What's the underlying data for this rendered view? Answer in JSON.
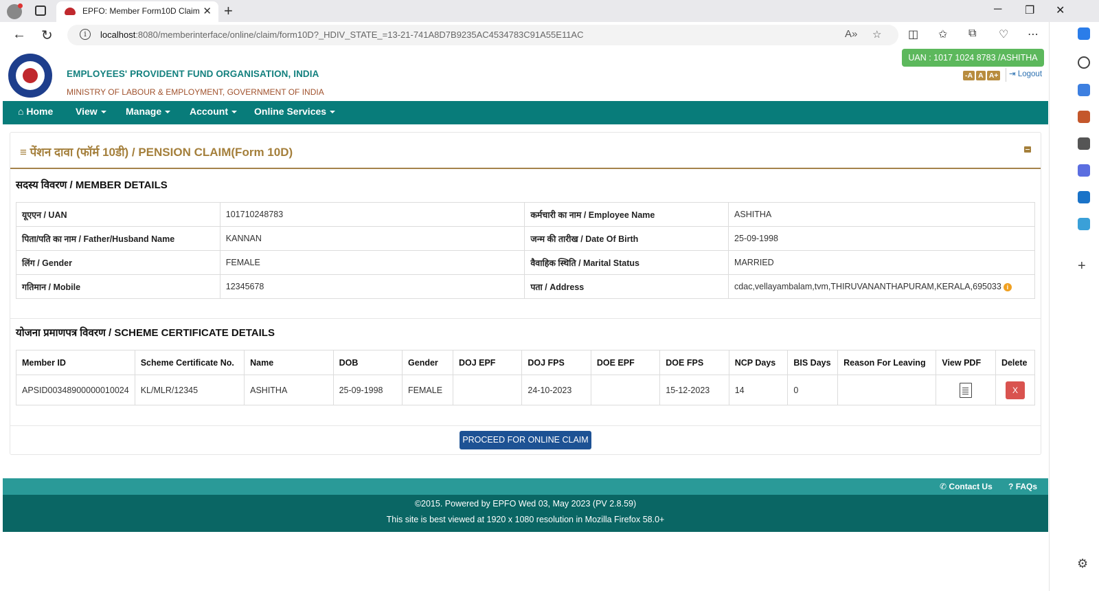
{
  "browser": {
    "tab_title": "EPFO: Member Form10D Claim",
    "url_host": "localhost",
    "url_rest": ":8080/memberinterface/online/claim/form10D?_HDIV_STATE_=13-21-741A8D7B9235AC4534783C91A55E11AC"
  },
  "header": {
    "org_name": "EMPLOYEES' PROVIDENT FUND ORGANISATION, INDIA",
    "ministry": "MINISTRY OF LABOUR & EMPLOYMENT, GOVERNMENT OF INDIA",
    "uan_badge": "UAN : 1017 1024 8783 /ASHITHA",
    "font_small": "-A",
    "font_normal": "A",
    "font_large": "A+",
    "logout": "Logout"
  },
  "nav": {
    "home": "Home",
    "view": "View",
    "manage": "Manage",
    "account": "Account",
    "online_services": "Online Services"
  },
  "panel": {
    "title": "पेंशन दावा (फॉर्म 10डी) / PENSION CLAIM(Form 10D)"
  },
  "member_details": {
    "heading": "सदस्य विवरण / MEMBER DETAILS",
    "rows": [
      {
        "l1": "यूएएन / UAN",
        "v1": "101710248783",
        "l2": "कर्मचारी का नाम / Employee Name",
        "v2": "ASHITHA"
      },
      {
        "l1": "पिता/पति का नाम / Father/Husband Name",
        "v1": "KANNAN",
        "l2": "जन्म की तारीख / Date Of Birth",
        "v2": "25-09-1998"
      },
      {
        "l1": "लिंग / Gender",
        "v1": "FEMALE",
        "l2": "वैवाहिक स्थिति / Marital Status",
        "v2": "MARRIED"
      },
      {
        "l1": "गतिमान / Mobile",
        "v1": "12345678",
        "l2": "पता / Address",
        "v2": "cdac,vellayambalam,tvm,THIRUVANANTHAPURAM,KERALA,695033"
      }
    ]
  },
  "scheme": {
    "heading": "योजना प्रमाणपत्र विवरण / SCHEME CERTIFICATE DETAILS",
    "columns": [
      "Member ID",
      "Scheme Certificate No.",
      "Name",
      "DOB",
      "Gender",
      "DOJ EPF",
      "DOJ FPS",
      "DOE EPF",
      "DOE FPS",
      "NCP Days",
      "BIS Days",
      "Reason For Leaving",
      "View PDF",
      "Delete"
    ],
    "row": {
      "member_id": "APSID00348900000010024",
      "cert_no": "KL/MLR/12345",
      "name": "ASHITHA",
      "dob": "25-09-1998",
      "gender": "FEMALE",
      "doj_epf": "",
      "doj_fps": "24-10-2023",
      "doe_epf": "",
      "doe_fps": "15-12-2023",
      "ncp_days": "14",
      "bis_days": "0",
      "reason": "",
      "delete_label": "X"
    }
  },
  "proceed_button": "PROCEED FOR ONLINE CLAIM",
  "footer": {
    "contact": "Contact Us",
    "faqs": "FAQs",
    "line1": "©2015. Powered by EPFO Wed 03, May 2023 (PV 2.8.59)",
    "line2": "This site is best viewed at 1920 x 1080 resolution in Mozilla Firefox 58.0+"
  },
  "colors": {
    "teal_nav": "#087c7a",
    "gold_title": "#a47f3b",
    "uan_green": "#5cb85c",
    "proceed_blue": "#1d5294",
    "delete_red": "#d9534f",
    "footer_dark": "#0a6664"
  }
}
